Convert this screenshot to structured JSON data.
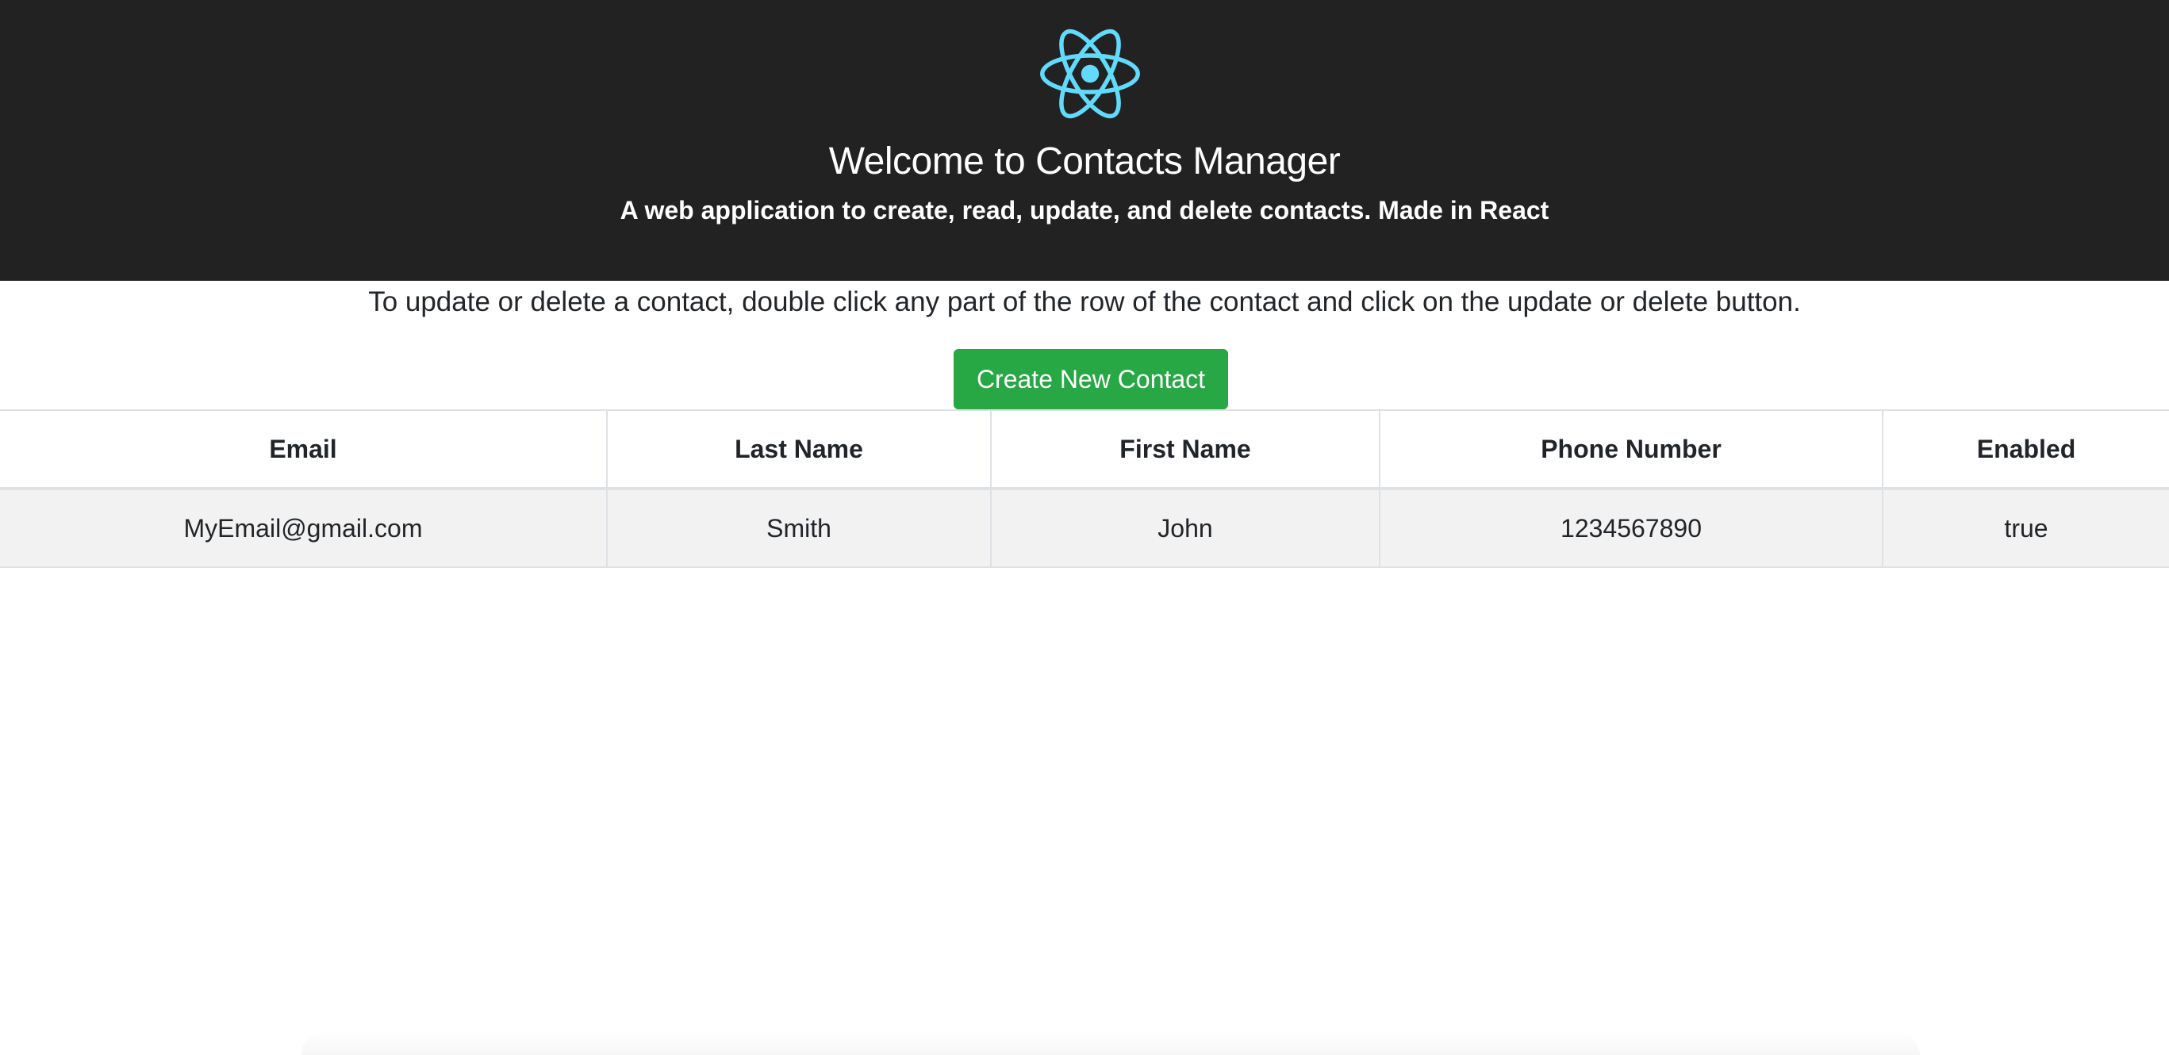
{
  "header": {
    "logo_icon": "react-atom-icon",
    "logo_color": "#61dafb",
    "background_color": "#222222",
    "title": "Welcome to Contacts Manager",
    "subtitle": "A web application to create, read, update, and delete contacts. Made in React"
  },
  "main": {
    "instructions": "To update or delete a contact, double click any part of the row of the contact and click on the update or delete button.",
    "create_button_label": "Create New Contact",
    "create_button_color": "#28a745"
  },
  "table": {
    "columns": [
      "Email",
      "Last Name",
      "First Name",
      "Phone Number",
      "Enabled"
    ],
    "rows": [
      [
        "MyEmail@gmail.com",
        "Smith",
        "John",
        "1234567890",
        "true"
      ]
    ]
  }
}
